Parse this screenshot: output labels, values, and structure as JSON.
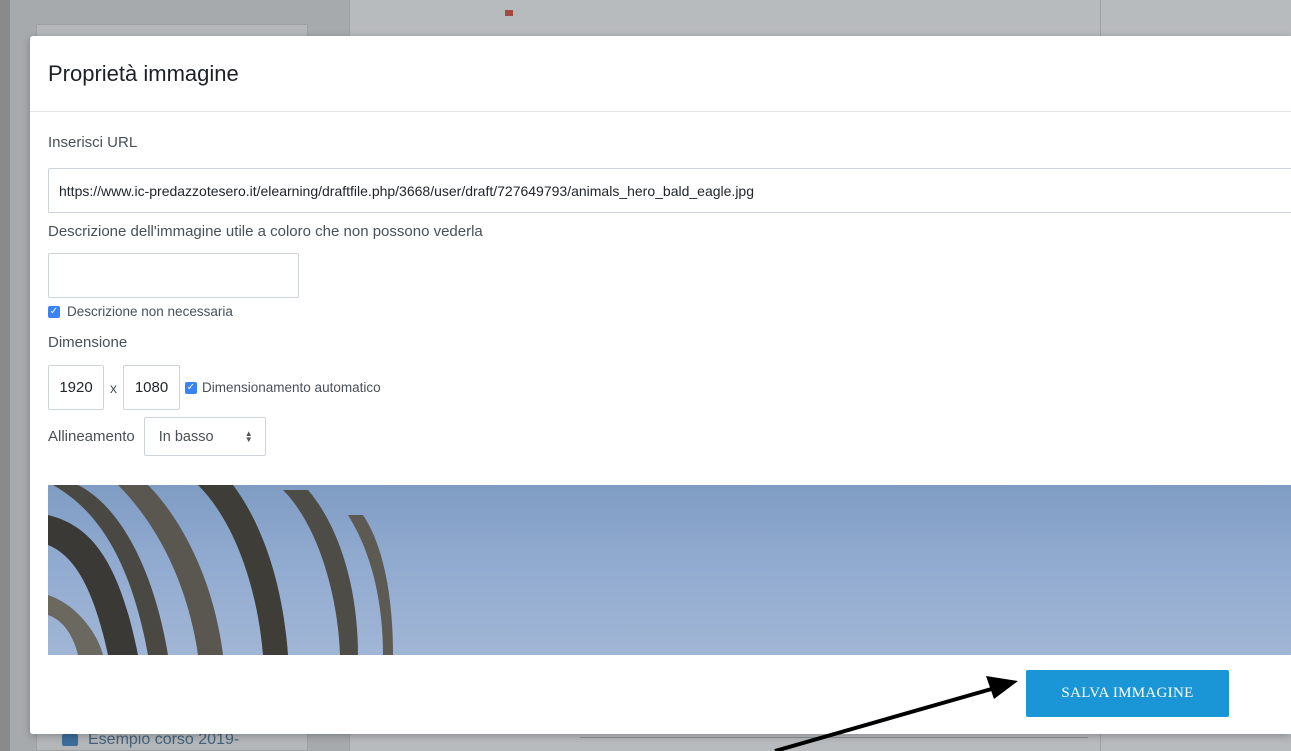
{
  "background": {
    "course_link": "Esempio corso 2019-"
  },
  "modal": {
    "title": "Proprietà immagine",
    "url_label": "Inserisci URL",
    "url_value": "https://www.ic-predazzotesero.it/elearning/draftfile.php/3668/user/draft/727649793/animals_hero_bald_eagle.jpg",
    "description_label": "Descrizione dell'immagine utile a coloro che non possono vederla",
    "description_value": "",
    "description_not_needed_label": "Descrizione non necessaria",
    "description_not_needed_checked": true,
    "size_label": "Dimensione",
    "width_value": "1920",
    "size_separator": "x",
    "height_value": "1080",
    "auto_size_label": "Dimensionamento automatico",
    "auto_size_checked": true,
    "alignment_label": "Allineamento",
    "alignment_selected": "In basso",
    "save_button_label": "SALVA IMMAGINE"
  },
  "colors": {
    "primary_button": "#1a96d6",
    "checkbox": "#3b82f6"
  },
  "icons": {
    "checkbox": "check-icon",
    "select": "updown-icon",
    "course": "course-icon",
    "annotation": "arrow-icon"
  }
}
